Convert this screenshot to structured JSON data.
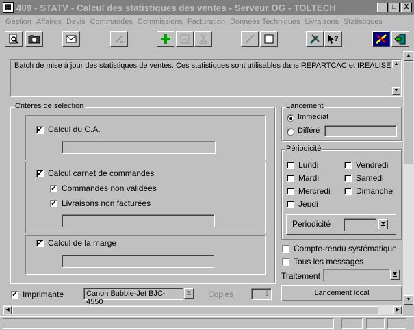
{
  "window": {
    "title": "409 - STATV - Calcul des statistiques des ventes - Serveur OG - TOLTECH",
    "icon": "app-icon",
    "controls": [
      "_",
      "□",
      "X"
    ]
  },
  "menu": [
    "Gestion",
    "Affaires",
    "Devis",
    "Commandes",
    "Commissions",
    "Facturation",
    "Données Techniques",
    "Livraisons",
    "Statistiques"
  ],
  "toolbar": {
    "buttons": [
      "preview-icon",
      "batch-icon",
      "mail-icon",
      "edit-icon",
      "add-icon",
      "save-icon",
      "cut-icon",
      "erase-icon",
      "blank-icon",
      "tools-icon",
      "help-icon",
      "launch-icon",
      "exit-icon"
    ]
  },
  "description": "Batch de mise à jour des statistiques de ventes. Ces statistiques sont utilisables dans REPARTCAC et IREALISE",
  "criteres": {
    "label": "Critères de sélection",
    "calcul_ca": {
      "label": "Calcul du C.A.",
      "checked": true,
      "check": "✓"
    },
    "calcul_carnet": {
      "label": "Calcul carnet de commandes",
      "checked": true,
      "check": "✓"
    },
    "commandes_non_validees": {
      "label": "Commandes non validées",
      "checked": true,
      "check": "✓"
    },
    "livraisons_non_facturees": {
      "label": "Livraisons non facturées",
      "checked": true,
      "check": "✓"
    },
    "calcul_marge": {
      "label": "Calcul de la marge",
      "checked": true,
      "check": "✓"
    }
  },
  "lancement": {
    "label": "Lancement",
    "immediat": "Immediat",
    "differe": "Différé",
    "selected": "immediat"
  },
  "periodicite": {
    "label": "Périodicité",
    "days": [
      "Lundi",
      "Mardi",
      "Mercredi",
      "Jeudi",
      "Vendredi",
      "Samedi",
      "Dimanche"
    ],
    "field_label": "Periodicité",
    "value": ""
  },
  "options": {
    "compte_rendu": "Compte-rendu systématique",
    "tous_messages": "Tous les messages",
    "traitement_label": "Traitement",
    "traitement_value": ""
  },
  "imprimante": {
    "label": "Imprimante",
    "checked": true,
    "check": "✓",
    "printer": "Canon Bubble-Jet BJC-4550",
    "copies_label": "Copies",
    "copies_value": "1"
  },
  "lancement_local_button": "Lancement local",
  "arrows": {
    "up": "▲",
    "down": "▼",
    "left": "◀",
    "right": "▶",
    "drop": "▼"
  }
}
